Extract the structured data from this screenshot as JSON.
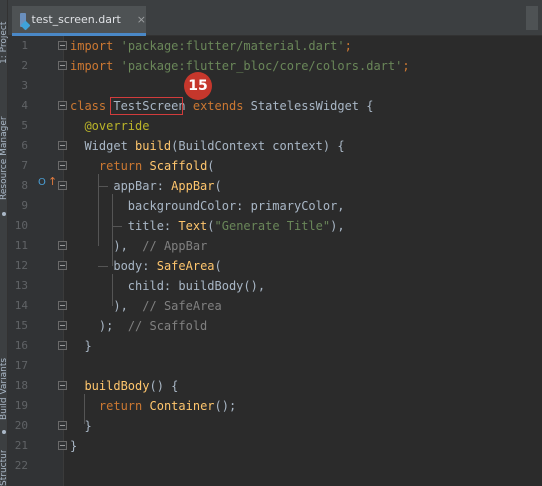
{
  "sidebar": {
    "labels": [
      "1: Project",
      "Resource Manager",
      "Build Variants",
      "Structure"
    ]
  },
  "tab": {
    "label": "test_screen.dart",
    "close": "×"
  },
  "gutter": {
    "line_numbers": [
      "1",
      "2",
      "3",
      "4",
      "5",
      "6",
      "7",
      "8",
      "9",
      "10",
      "11",
      "12",
      "13",
      "14",
      "15",
      "16",
      "17",
      "18",
      "19",
      "20",
      "21",
      "22"
    ],
    "override_marker": "O",
    "override_arrow": "↑"
  },
  "code": {
    "l1": {
      "kw": "import",
      "str": "'package:flutter/material.dart'",
      "end": ";"
    },
    "l2": {
      "kw": "import",
      "str": "'package:flutter_bloc/core/colors.dart'",
      "end": ";"
    },
    "l4": {
      "kw1": "class",
      "name": "TestScreen",
      "kw2": "extends",
      "rest": "StatelessWidget {"
    },
    "l5": {
      "ann": "@override"
    },
    "l6": {
      "a": "Widget ",
      "fn": "build",
      "b": "(BuildContext context) {"
    },
    "l7": {
      "kw": "return",
      "cls": "Scaffold",
      "b": "("
    },
    "l8": {
      "a": "appBar: ",
      "cls": "AppBar",
      "b": "("
    },
    "l9": {
      "a": "backgroundColor: primaryColor,"
    },
    "l10": {
      "a": "title: ",
      "cls": "Text",
      "b": "(",
      "str": "\"Generate Title\"",
      "c": "),"
    },
    "l11": {
      "a": "),  ",
      "cm": "// AppBar"
    },
    "l12": {
      "a": "body: ",
      "cls": "SafeArea",
      "b": "("
    },
    "l13": {
      "a": "child: buildBody(),"
    },
    "l14": {
      "a": "),  ",
      "cm": "// SafeArea"
    },
    "l15": {
      "a": ");  ",
      "cm": "// Scaffold"
    },
    "l16": {
      "a": "}"
    },
    "l18": {
      "fn": "buildBody",
      "a": "() {"
    },
    "l19": {
      "kw": "return",
      "cls": "Container",
      "b": "();"
    },
    "l20": {
      "a": "}"
    },
    "l21": {
      "a": "}"
    }
  },
  "annotation": {
    "badge": "15"
  },
  "colors": {
    "keyword": "#cc7832",
    "string": "#6a8759",
    "annotation": "#bbb529",
    "function": "#ffc66d",
    "comment": "#808080",
    "highlight_box": "#d23c3c",
    "badge": "#c6372c"
  }
}
